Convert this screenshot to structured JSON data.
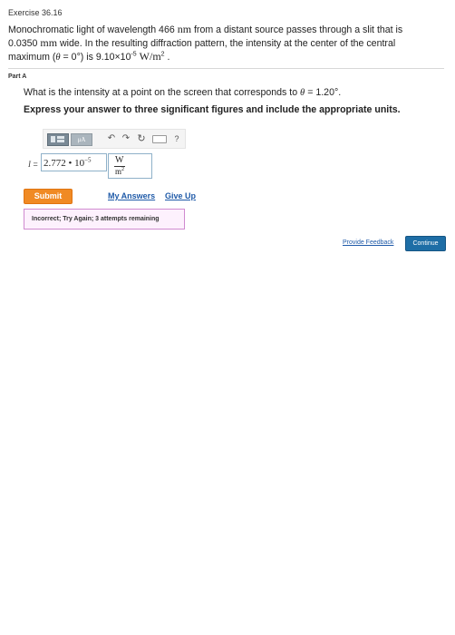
{
  "exercise": {
    "title": "Exercise 36.16"
  },
  "problem": {
    "line1_a": "Monochromatic light of wavelength 466 ",
    "unit_nm": "nm",
    "line1_b": " from a distant source passes through a slit that is",
    "line2_a": "0.0350 ",
    "unit_mm": "mm",
    "line2_b": " wide. In the resulting diffraction pattern, the intensity at the center of the central",
    "line3_a": "maximum (",
    "theta": "θ",
    "line3_b": " = 0°) is 9.10×10",
    "exponent": "-5",
    "line3_c": " ",
    "unit_intensity": "W/m",
    "unit_power": "2",
    "line3_d": " ."
  },
  "part": {
    "label": "Part A",
    "question_a": "What is the intensity at a point on the screen that corresponds to ",
    "question_theta": "θ",
    "question_b": " = 1.20°.",
    "instruction": "Express your answer to three significant figures and include the appropriate units."
  },
  "toolbar": {
    "symbols_label": "μA",
    "undo": "↶",
    "redo": "↷",
    "reset": "↻",
    "help": "?"
  },
  "answer": {
    "label_symbol": "I",
    "label_eq": " =",
    "value_mantissa": "2.772 • 10",
    "value_exponent": "−5",
    "unit_numerator": "W",
    "unit_denominator": "m",
    "unit_denominator_power": "2"
  },
  "actions": {
    "submit_label": "Submit",
    "my_answers_label": "My Answers",
    "give_up_label": "Give Up"
  },
  "feedback": {
    "message": "Incorrect; Try Again; 3 attempts remaining"
  },
  "footer": {
    "provide_feedback_label": "Provide Feedback",
    "continue_label": "Continue"
  },
  "colors": {
    "submit": "#f08a24",
    "continue": "#1e6ea6",
    "link": "#1f5aa8",
    "feedback_border": "#d08ad0"
  }
}
